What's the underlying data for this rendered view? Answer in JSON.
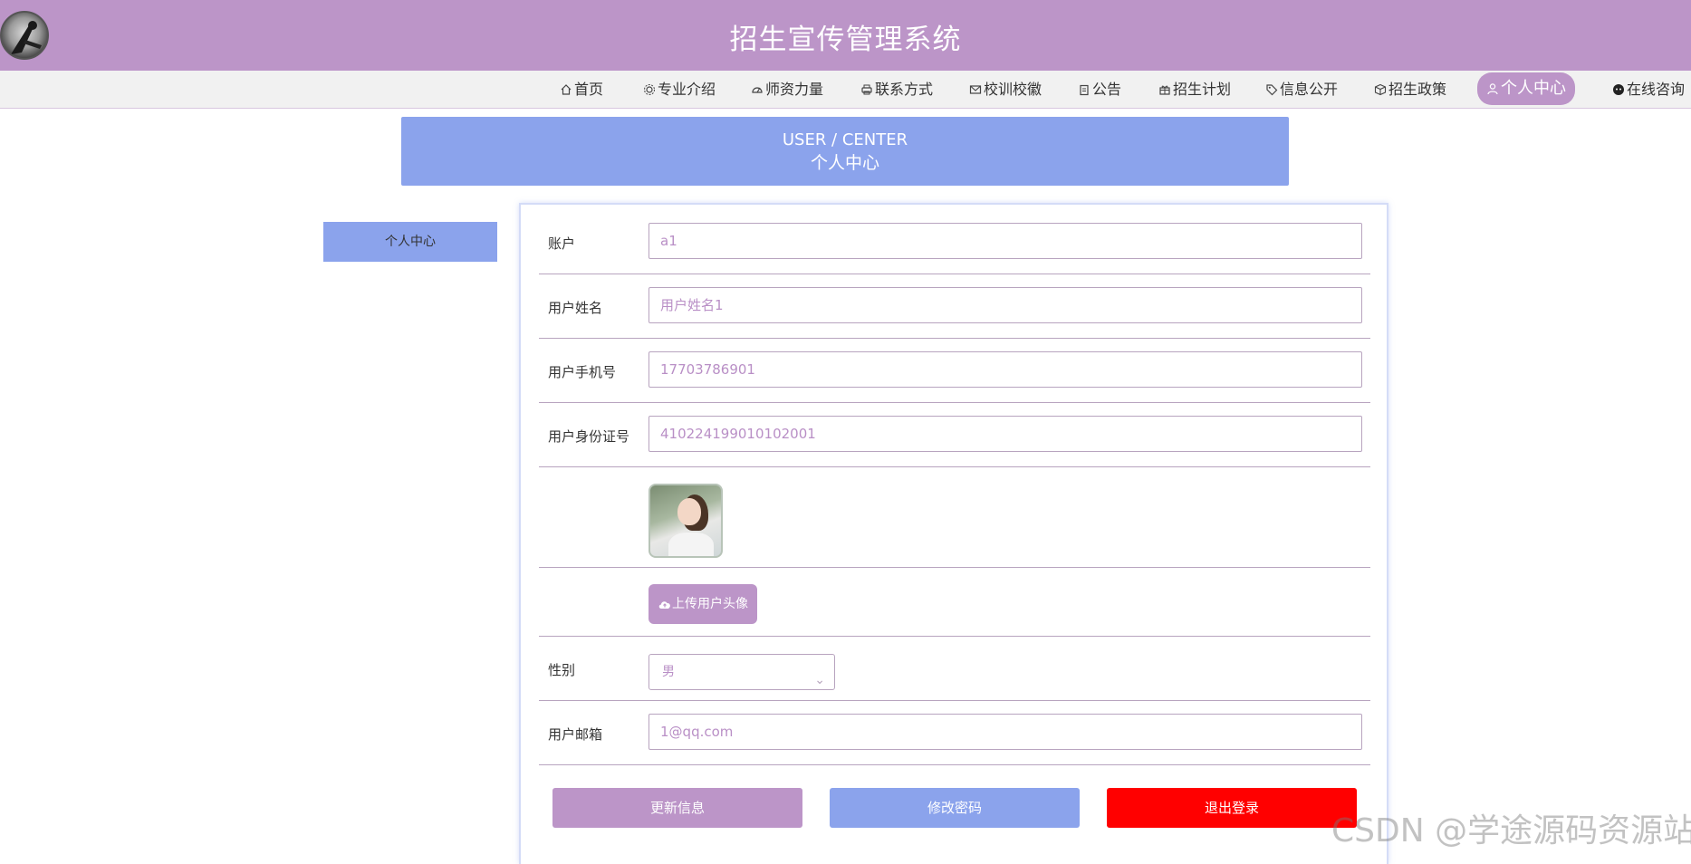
{
  "header": {
    "title": "招生宣传管理系统"
  },
  "nav": {
    "items": [
      {
        "label": "首页",
        "icon": "home-icon"
      },
      {
        "label": "专业介绍",
        "icon": "gear-icon"
      },
      {
        "label": "师资力量",
        "icon": "gauge-icon"
      },
      {
        "label": "联系方式",
        "icon": "printer-icon"
      },
      {
        "label": "校训校徽",
        "icon": "mail-icon"
      },
      {
        "label": "公告",
        "icon": "clipboard-icon"
      },
      {
        "label": "招生计划",
        "icon": "gift-icon"
      },
      {
        "label": "信息公开",
        "icon": "tag-icon"
      },
      {
        "label": "招生政策",
        "icon": "box-icon"
      },
      {
        "label": "个人中心",
        "icon": "user-icon"
      },
      {
        "label": "在线咨询",
        "icon": "chat-icon"
      }
    ],
    "active": "个人中心"
  },
  "banner": {
    "en": "USER / CENTER",
    "cn": "个人中心"
  },
  "sidebar": {
    "items": [
      {
        "label": "个人中心"
      }
    ]
  },
  "form": {
    "account": {
      "label": "账户",
      "value": "a1"
    },
    "name": {
      "label": "用户姓名",
      "value": "用户姓名1"
    },
    "phone": {
      "label": "用户手机号",
      "value": "17703786901"
    },
    "id_card": {
      "label": "用户身份证号",
      "value": "410224199010102001"
    },
    "upload": {
      "label": "上传用户头像"
    },
    "gender": {
      "label": "性别",
      "value": "男"
    },
    "email": {
      "label": "用户邮箱",
      "value": "1@qq.com"
    }
  },
  "actions": {
    "update": "更新信息",
    "change_password": "修改密码",
    "logout": "退出登录"
  },
  "colors": {
    "primary": "#bc95c8",
    "secondary": "#8ba3ec",
    "danger": "#ff0000"
  },
  "watermark": "CSDN @学途源码资源站"
}
